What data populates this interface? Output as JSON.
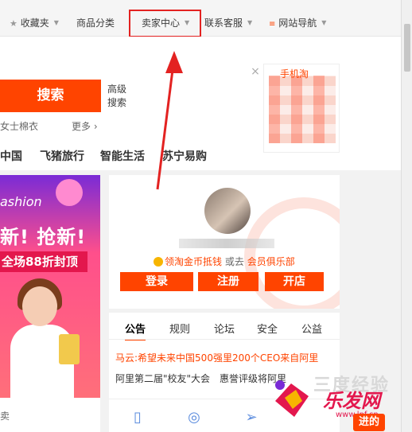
{
  "topbar": {
    "favorites": "收藏夹",
    "categories": "商品分类",
    "seller_center": "卖家中心",
    "customer_service": "联系客服",
    "site_nav": "网站导航"
  },
  "search": {
    "button": "搜索",
    "advanced": "高级搜索",
    "hot_word": "女士棉衣",
    "more": "更多"
  },
  "nav": {
    "items": [
      "中国",
      "飞猪旅行",
      "智能生活",
      "苏宁易购"
    ]
  },
  "qr": {
    "title": "手机淘"
  },
  "banner": {
    "tag": "ashion",
    "headline": "新! 抢新!",
    "discount": "全场88折封顶"
  },
  "bottom_left": {
    "label": "卖"
  },
  "member": {
    "points_link": "领淘金币抵钱",
    "or": "或去",
    "club_link": "会员俱乐部",
    "login": "登录",
    "register": "注册",
    "open_shop": "开店"
  },
  "notice": {
    "tabs": [
      "公告",
      "规则",
      "论坛",
      "安全",
      "公益"
    ],
    "headline": "马云:希望未来中国500强里200个CEO来自阿里",
    "item_a": "阿里第二届\"校友\"大会",
    "item_b": "惠誉评级将阿里"
  },
  "watermark": {
    "text": "三度经验",
    "brand": "乐发网",
    "url": "www.lpf.cn",
    "button": "进的"
  },
  "colors": {
    "accent": "#ff4400",
    "highlight": "#e32221"
  }
}
